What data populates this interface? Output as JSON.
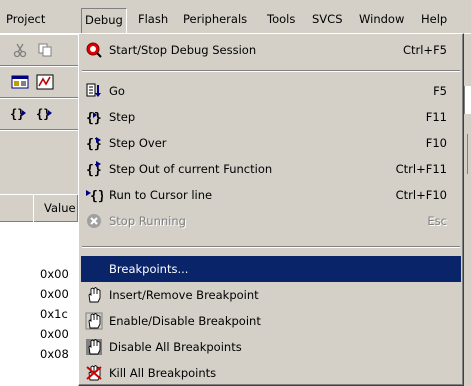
{
  "menubar": {
    "items": [
      {
        "label": "Project"
      },
      {
        "label": "Debug"
      },
      {
        "label": "Flash"
      },
      {
        "label": "Peripherals"
      },
      {
        "label": "Tools"
      },
      {
        "label": "SVCS"
      },
      {
        "label": "Window"
      },
      {
        "label": "Help"
      }
    ]
  },
  "watch": {
    "column_header": "Value",
    "values": [
      "0x00",
      "0x00",
      "0x1c",
      "0x00",
      "0x08"
    ]
  },
  "debug_menu": {
    "items": [
      {
        "label": "Start/Stop Debug Session",
        "shortcut": "Ctrl+F5",
        "icon": "debug-session-icon"
      },
      {
        "label": "Go",
        "shortcut": "F5",
        "icon": "go-icon"
      },
      {
        "label": "Step",
        "shortcut": "F11",
        "icon": "step-icon"
      },
      {
        "label": "Step Over",
        "shortcut": "F10",
        "icon": "step-over-icon"
      },
      {
        "label": "Step Out of current Function",
        "shortcut": "Ctrl+F11",
        "icon": "step-out-icon"
      },
      {
        "label": "Run to Cursor line",
        "shortcut": "Ctrl+F10",
        "icon": "run-to-cursor-icon"
      },
      {
        "label": "Stop Running",
        "shortcut": "Esc",
        "icon": "stop-icon",
        "disabled": true
      },
      {
        "label": "Breakpoints...",
        "shortcut": "",
        "highlighted": true
      },
      {
        "label": "Insert/Remove Breakpoint",
        "shortcut": "",
        "icon": "hand-icon"
      },
      {
        "label": "Enable/Disable Breakpoint",
        "shortcut": "",
        "icon": "hand-enable-icon"
      },
      {
        "label": "Disable All Breakpoints",
        "shortcut": "",
        "icon": "hand-disable-all-icon"
      },
      {
        "label": "Kill All Breakpoints",
        "shortcut": "",
        "icon": "hand-kill-icon"
      }
    ]
  },
  "colors": {
    "face": "#d4d0c8",
    "highlight": "#0a246a",
    "disabled": "#808080"
  }
}
